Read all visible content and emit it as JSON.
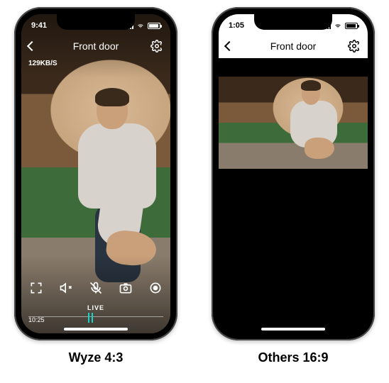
{
  "phoneA": {
    "status_time": "9:41",
    "header_title": "Front door",
    "bitrate": "129KB/S",
    "live_label": "LIVE",
    "timeline_time": "10:25",
    "caption": "Wyze 4:3"
  },
  "phoneB": {
    "status_time": "1:05",
    "header_title": "Front door",
    "caption": "Others 16:9"
  }
}
